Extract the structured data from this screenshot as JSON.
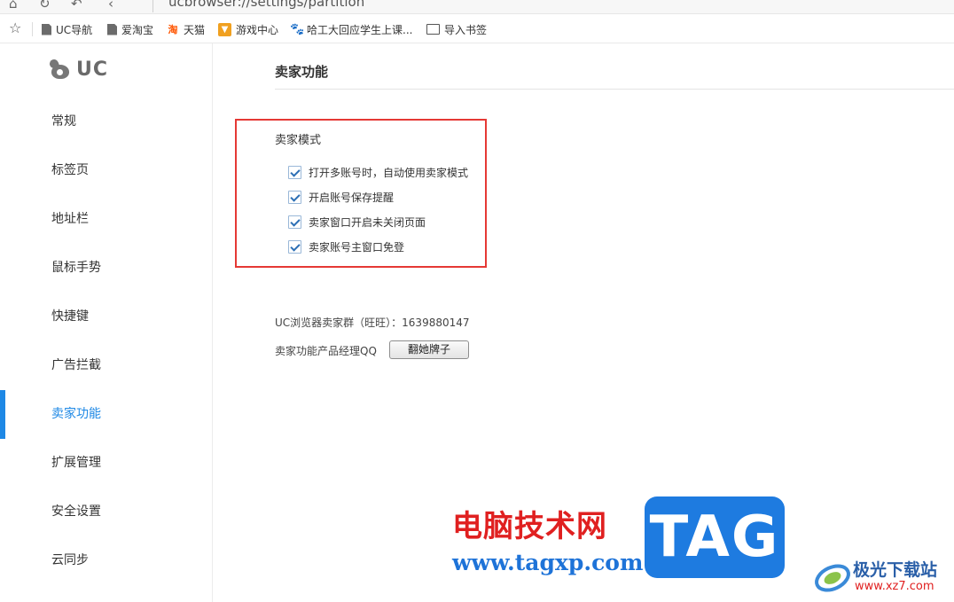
{
  "browser": {
    "url": "ucbrowser://settings/partition",
    "nav_icons": [
      "home-icon",
      "refresh-icon",
      "undo-icon",
      "back-icon"
    ]
  },
  "bookmarks": {
    "star_icon": "star-icon",
    "items": [
      {
        "label": "UC导航",
        "icon": "page-icon"
      },
      {
        "label": "爱淘宝",
        "icon": "page-icon"
      },
      {
        "label": "天猫",
        "icon": "taobao-icon"
      },
      {
        "label": "游戏中心",
        "icon": "game-icon"
      },
      {
        "label": "哈工大回应学生上课...",
        "icon": "baidu-paw-icon"
      },
      {
        "label": "导入书签",
        "icon": "import-icon"
      }
    ]
  },
  "sidebar": {
    "logo_text": "UC",
    "items": [
      {
        "label": "常规"
      },
      {
        "label": "标签页"
      },
      {
        "label": "地址栏"
      },
      {
        "label": "鼠标手势"
      },
      {
        "label": "快捷键"
      },
      {
        "label": "广告拦截"
      },
      {
        "label": "卖家功能",
        "active": true
      },
      {
        "label": "扩展管理"
      },
      {
        "label": "安全设置"
      },
      {
        "label": "云同步"
      }
    ]
  },
  "main": {
    "title": "卖家功能",
    "seller_mode": {
      "title": "卖家模式",
      "options": [
        {
          "label": "打开多账号时，自动使用卖家模式",
          "checked": true
        },
        {
          "label": "开启账号保存提醒",
          "checked": true
        },
        {
          "label": "卖家窗口开启未关闭页面",
          "checked": true
        },
        {
          "label": "卖家账号主窗口免登",
          "checked": true
        }
      ]
    },
    "group_info": "UC浏览器卖家群（旺旺）：1639880147",
    "pm_label": "卖家功能产品经理QQ",
    "flip_button": "翻她牌子"
  },
  "watermark": {
    "site_name": "电脑技术网",
    "site_url": "www.tagxp.com",
    "tag": "TAG",
    "site2_name": "极光下载站",
    "site2_url": "www.xz7.com"
  },
  "colors": {
    "accent": "#1e88e5",
    "highlight_border": "#e53935",
    "checkbox_check": "#2c6fb5"
  }
}
